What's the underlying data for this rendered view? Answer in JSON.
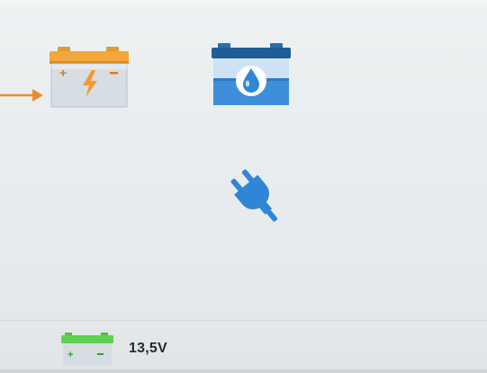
{
  "screen": {
    "menu_items": [
      {
        "id": "battery-agm",
        "icon": "battery-charge-icon",
        "selected": true,
        "accent": "#f3a63a"
      },
      {
        "id": "battery-wet",
        "icon": "battery-water-drop-icon",
        "selected": false,
        "accent": "#2f86d6"
      },
      {
        "id": "power-supply",
        "icon": "power-plug-icon",
        "selected": false,
        "accent": "#2f86d6"
      }
    ],
    "selector": {
      "icon": "arrow-right-icon",
      "color": "#f08a2c"
    }
  },
  "status_bar": {
    "battery_icon": "battery-status-icon",
    "battery_color": "#5ed24e",
    "voltage": "13,5V"
  }
}
